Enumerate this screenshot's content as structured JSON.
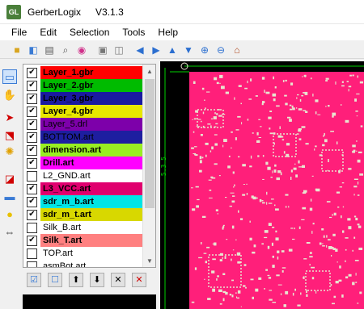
{
  "window": {
    "app_icon": "GL",
    "title": "GerberLogix",
    "version": "V3.1.3"
  },
  "menu": [
    "File",
    "Edit",
    "Selection",
    "Tools",
    "Help"
  ],
  "toolbar_icons": [
    "open-folder-icon",
    "open-file-icon",
    "print-icon",
    "print-preview-icon",
    "color-wheel-icon",
    "export-icon",
    "save-image-icon",
    "pan-left-icon",
    "pan-right-icon",
    "pan-up-icon",
    "pan-down-icon",
    "zoom-in-icon",
    "zoom-out-icon",
    "home-icon"
  ],
  "tool_icons": [
    "select-icon",
    "pan-hand-icon",
    "pointer-icon",
    "select-area-icon",
    "highlight-icon",
    "measure-icon",
    "rectangle-icon",
    "light-icon",
    "scale-icon"
  ],
  "layers": [
    {
      "name": "Layer_1.gbr",
      "checked": true,
      "color": "#ff0000",
      "text_color": "#000000",
      "bold": true
    },
    {
      "name": "Layer_2.gbr",
      "checked": true,
      "color": "#00bb00",
      "text_color": "#000000",
      "bold": true
    },
    {
      "name": "Layer_3.gbr",
      "checked": true,
      "color": "#1a1aa0",
      "text_color": "#000000",
      "bold": true
    },
    {
      "name": "Layer_4.gbr",
      "checked": true,
      "color": "#e8e800",
      "text_color": "#000000",
      "bold": true
    },
    {
      "name": "Layer_5.drl",
      "checked": true,
      "color": "#7d00aa",
      "text_color": "#000000",
      "bold": false
    },
    {
      "name": "BOTTOM.art",
      "checked": true,
      "color": "#1e1ea0",
      "text_color": "#000000",
      "bold": false
    },
    {
      "name": "dimension.art",
      "checked": true,
      "color": "#99ee22",
      "text_color": "#000000",
      "bold": true
    },
    {
      "name": "Drill.art",
      "checked": true,
      "color": "#ff00ff",
      "text_color": "#000000",
      "bold": true
    },
    {
      "name": "L2_GND.art",
      "checked": false,
      "color": "#ffffff",
      "text_color": "#000000",
      "bold": false
    },
    {
      "name": "L3_VCC.art",
      "checked": true,
      "color": "#e0006e",
      "text_color": "#000000",
      "bold": true
    },
    {
      "name": "sdr_m_b.art",
      "checked": true,
      "color": "#00e5e5",
      "text_color": "#000000",
      "bold": true
    },
    {
      "name": "sdr_m_t.art",
      "checked": true,
      "color": "#d8d800",
      "text_color": "#000000",
      "bold": true
    },
    {
      "name": "Silk_B.art",
      "checked": false,
      "color": "#ffffff",
      "text_color": "#000000",
      "bold": false
    },
    {
      "name": "Silk_T.art",
      "checked": true,
      "color": "#ff8080",
      "text_color": "#000000",
      "bold": true
    },
    {
      "name": "TOP.art",
      "checked": false,
      "color": "#ffffff",
      "text_color": "#000000",
      "bold": false
    },
    {
      "name": "asmBot.art",
      "checked": false,
      "color": "#ffffff",
      "text_color": "#000000",
      "bold": false
    }
  ],
  "panel_buttons": [
    "check-all-icon",
    "uncheck-all-icon",
    "move-up-icon",
    "move-down-icon",
    "remove-icon",
    "remove-all-icon"
  ],
  "canvas": {
    "dimension_label": "5.3 5"
  },
  "colors": {
    "board": "#ff1f7a",
    "feature": "#e8e4d0",
    "background": "#000000",
    "dimension": "#00d000"
  }
}
